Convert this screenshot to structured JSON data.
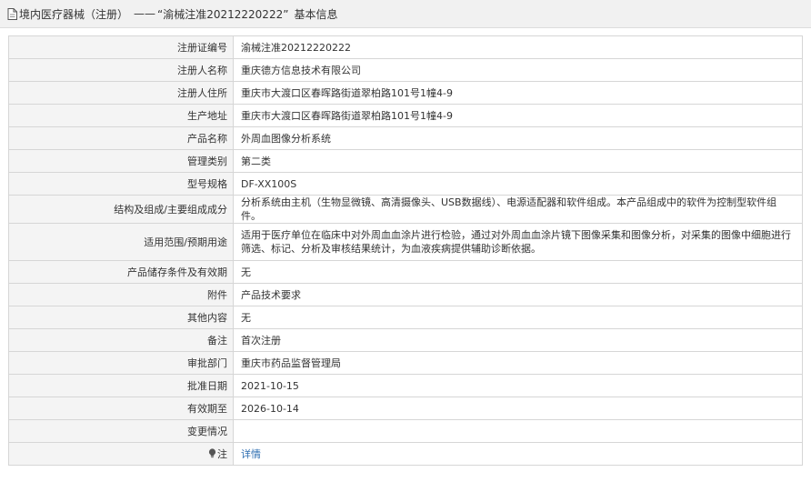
{
  "header": {
    "category": "境内医疗器械（注册）",
    "separator": "——",
    "record_title": "“渝械注准20212220222”",
    "suffix": "基本信息"
  },
  "fields": [
    {
      "label": "注册证编号",
      "value": "渝械注准20212220222"
    },
    {
      "label": "注册人名称",
      "value": "重庆德方信息技术有限公司"
    },
    {
      "label": "注册人住所",
      "value": "重庆市大渡口区春晖路街道翠柏路101号1幢4-9"
    },
    {
      "label": "生产地址",
      "value": "重庆市大渡口区春晖路街道翠柏路101号1幢4-9"
    },
    {
      "label": "产品名称",
      "value": "外周血图像分析系统"
    },
    {
      "label": "管理类别",
      "value": "第二类"
    },
    {
      "label": "型号规格",
      "value": "DF-XX100S"
    },
    {
      "label": "结构及组成/主要组成成分",
      "value": "分析系统由主机（生物显微镜、高清摄像头、USB数据线）、电源适配器和软件组成。本产品组成中的软件为控制型软件组件。"
    },
    {
      "label": "适用范围/预期用途",
      "value": "适用于医疗单位在临床中对外周血血涂片进行检验，通过对外周血血涂片镜下图像采集和图像分析，对采集的图像中细胞进行筛选、标记、分析及审核结果统计，为血液疾病提供辅助诊断依据。"
    },
    {
      "label": "产品储存条件及有效期",
      "value": "无"
    },
    {
      "label": "附件",
      "value": "产品技术要求"
    },
    {
      "label": "其他内容",
      "value": "无"
    },
    {
      "label": "备注",
      "value": "首次注册"
    },
    {
      "label": "审批部门",
      "value": "重庆市药品监督管理局"
    },
    {
      "label": "批准日期",
      "value": "2021-10-15"
    },
    {
      "label": "有效期至",
      "value": "2026-10-14"
    },
    {
      "label": "变更情况",
      "value": ""
    }
  ],
  "note": {
    "label": "注",
    "icon": "lightbulb-icon",
    "link_text": "详情"
  },
  "colors": {
    "link": "#2b6cb0",
    "label_bg": "#f4f4f4",
    "border": "#d6d6d6",
    "title_bg": "#f1f1f1"
  }
}
